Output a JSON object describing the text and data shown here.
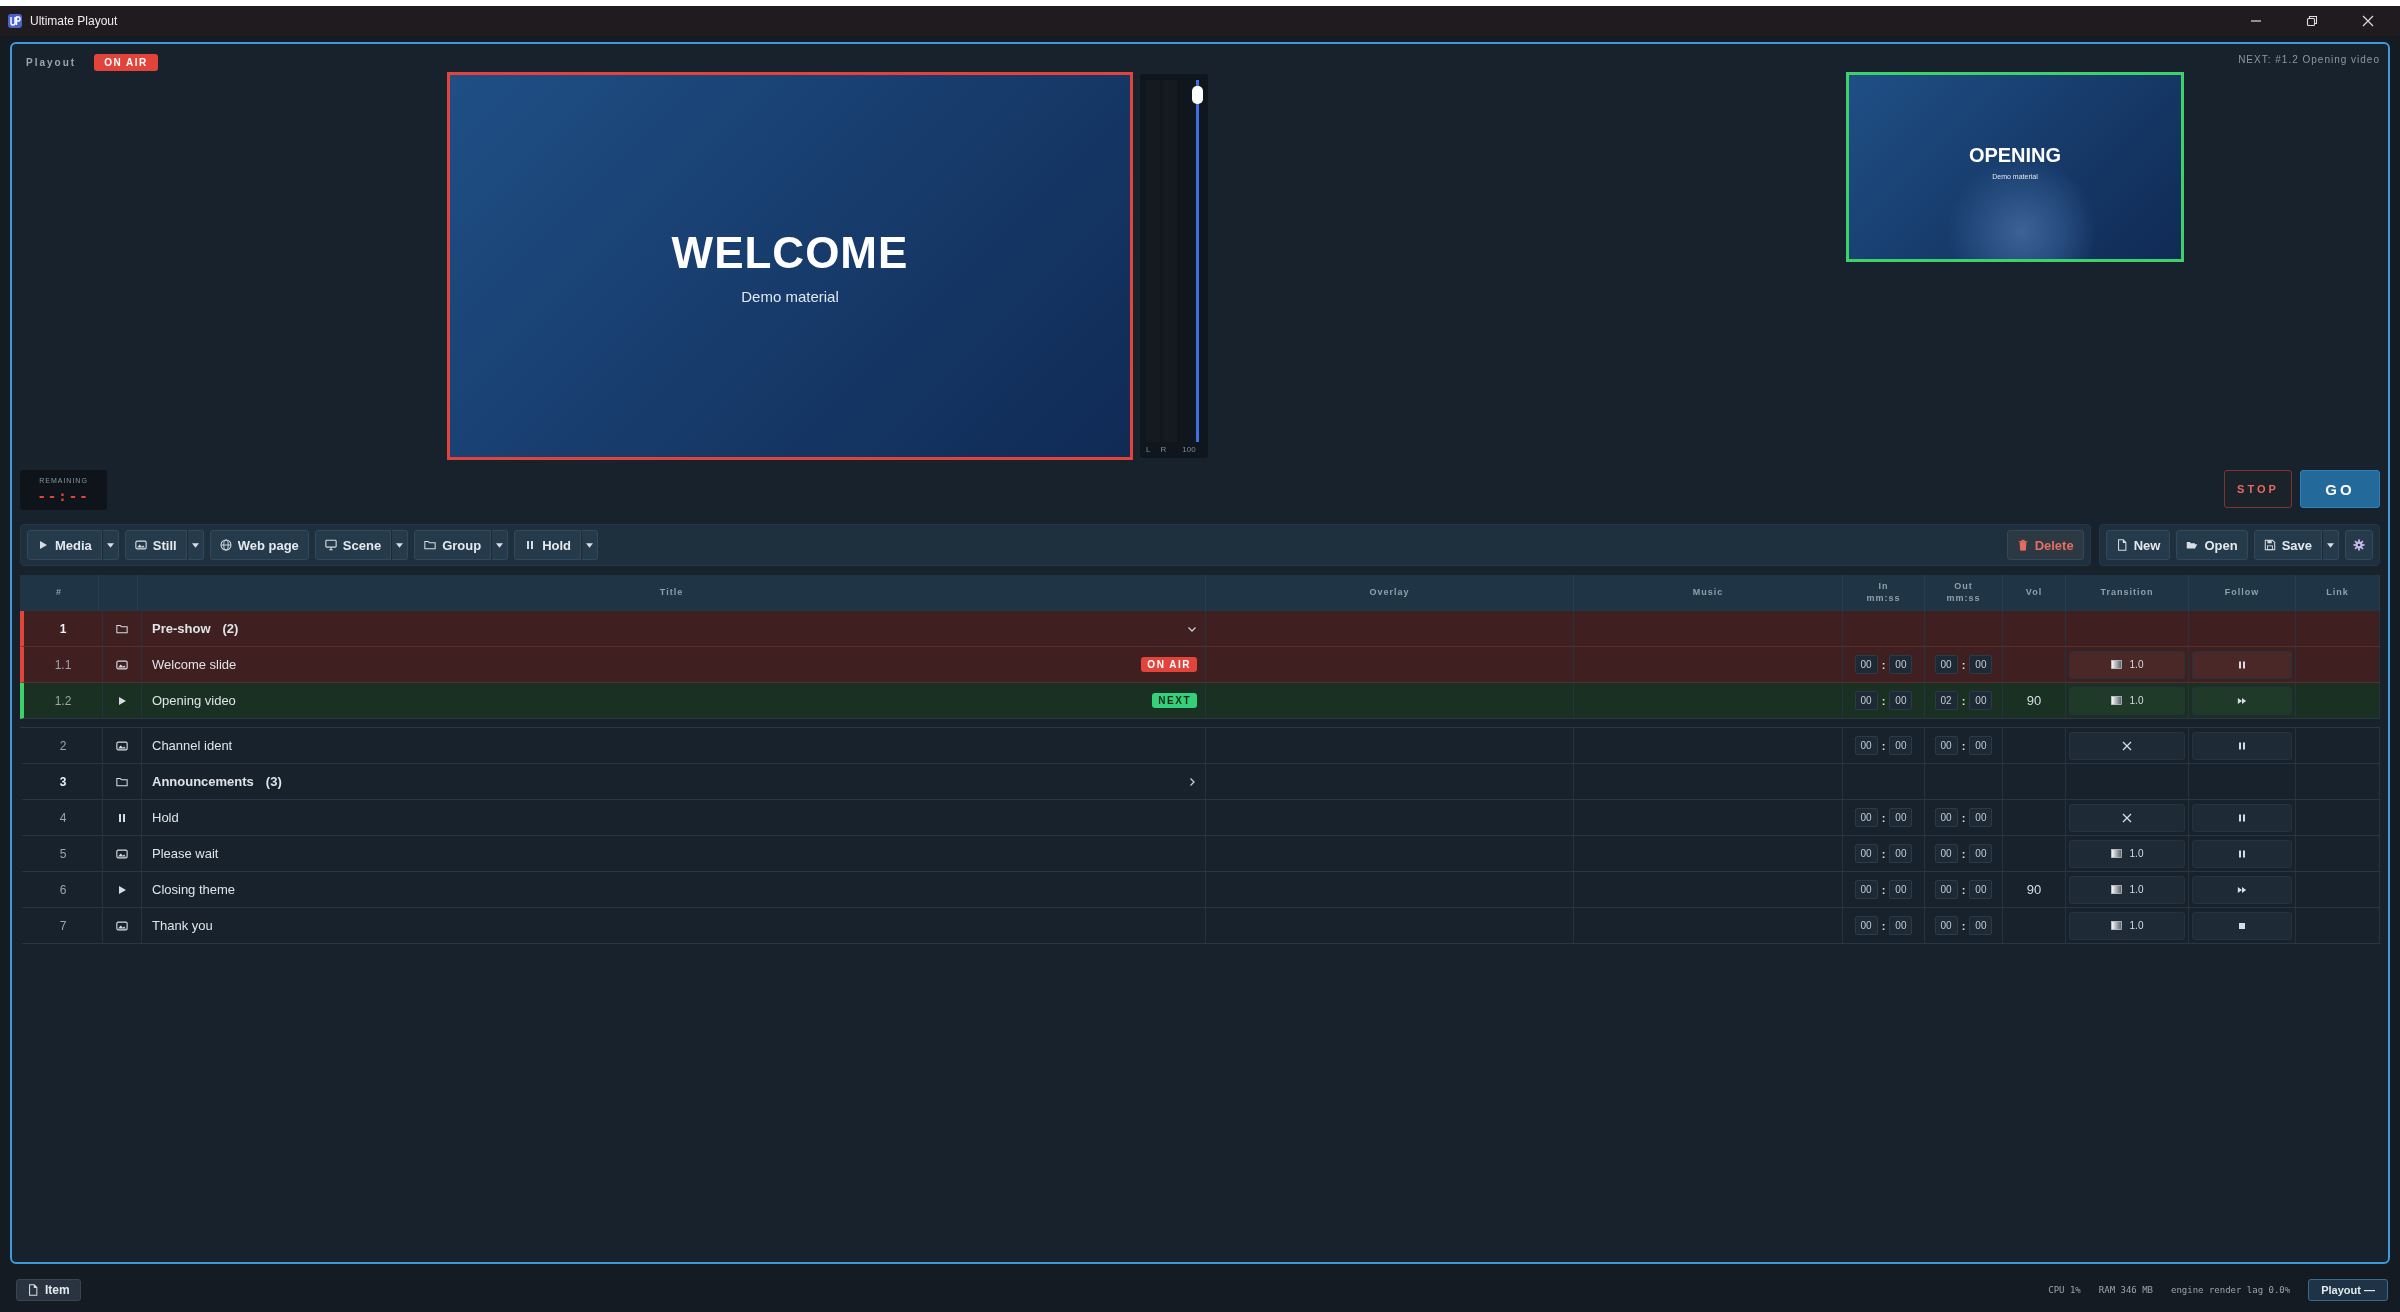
{
  "window": {
    "title": "Ultimate Playout"
  },
  "header": {
    "label": "Playout",
    "status": "ON AIR",
    "next_info": "NEXT: #1.2  Opening video"
  },
  "program": {
    "title": "WELCOME",
    "subtitle": "Demo material"
  },
  "meter": {
    "channels": [
      "L",
      "R"
    ],
    "volume_label": "100",
    "level": 1.0
  },
  "preview": {
    "title": "OPENING",
    "subtitle": "Demo material"
  },
  "remaining": {
    "label": "REMAINING",
    "value": "--:--"
  },
  "transport": [
    {
      "kind": "stop",
      "label": "STOP"
    },
    {
      "kind": "go",
      "label": "GO"
    }
  ],
  "toolbar": {
    "add": [
      {
        "kind": "media",
        "label": "Media",
        "dropdown": true
      },
      {
        "kind": "still",
        "label": "Still",
        "dropdown": true
      },
      {
        "kind": "web",
        "label": "Web page",
        "dropdown": false
      },
      {
        "kind": "scene",
        "label": "Scene",
        "dropdown": true
      },
      {
        "kind": "group",
        "label": "Group",
        "dropdown": true
      },
      {
        "kind": "hold",
        "label": "Hold",
        "dropdown": true
      }
    ],
    "delete": "Delete",
    "file": [
      {
        "kind": "new",
        "label": "New",
        "dropdown": false
      },
      {
        "kind": "open",
        "label": "Open",
        "dropdown": false
      },
      {
        "kind": "save",
        "label": "Save",
        "dropdown": true
      }
    ]
  },
  "table": {
    "columns": [
      {
        "label": "#"
      },
      {
        "label": "Title"
      },
      {
        "label": "Overlay"
      },
      {
        "label": "Music"
      },
      {
        "label": "In",
        "sub": "mm:ss"
      },
      {
        "label": "Out",
        "sub": "mm:ss"
      },
      {
        "label": "Vol"
      },
      {
        "label": "Transition"
      },
      {
        "label": "Follow"
      },
      {
        "label": "Link"
      }
    ],
    "rows": [
      {
        "num": "1",
        "kind": "group",
        "title": "Pre-show",
        "count": "(2)",
        "expanded": true,
        "on_air": true,
        "next": false,
        "children": [
          {
            "num": "1.1",
            "kind": "image",
            "title": "Welcome slide",
            "on_air": true,
            "next": false,
            "badge": "ON AIR",
            "in": {
              "min": "00",
              "sep": ":",
              "sec": "00"
            },
            "out": {
              "min": "00",
              "sep": ":",
              "sec": "00"
            },
            "transition": {
              "kind": "fade",
              "duration": "1.0"
            },
            "follow": {
              "kind": "hold"
            }
          },
          {
            "num": "1.2",
            "kind": "video",
            "title": "Opening video",
            "on_air": false,
            "next": true,
            "badge": "NEXT",
            "in": {
              "min": "00",
              "sep": ":",
              "sec": "00"
            },
            "out": {
              "min": "02",
              "sep": ":",
              "sec": "00"
            },
            "vol": "90",
            "transition": {
              "kind": "fade",
              "duration": "1.0"
            },
            "follow": {
              "kind": "next"
            }
          }
        ]
      },
      {
        "num": "2",
        "kind": "image",
        "title": "Channel ident",
        "on_air": false,
        "next": false,
        "in": {
          "min": "00",
          "sep": ":",
          "sec": "00"
        },
        "out": {
          "min": "00",
          "sep": ":",
          "sec": "00"
        },
        "transition": {
          "kind": "cut"
        },
        "follow": {
          "kind": "hold"
        }
      },
      {
        "num": "3",
        "kind": "group",
        "title": "Announcements",
        "count": "(3)",
        "expanded": false,
        "on_air": false,
        "next": false
      },
      {
        "num": "4",
        "kind": "hold",
        "title": "Hold",
        "on_air": false,
        "next": false,
        "in": {
          "min": "00",
          "sep": ":",
          "sec": "00"
        },
        "out": {
          "min": "00",
          "sep": ":",
          "sec": "00"
        },
        "transition": {
          "kind": "cut"
        },
        "follow": {
          "kind": "hold"
        }
      },
      {
        "num": "5",
        "kind": "image",
        "title": "Please wait",
        "on_air": false,
        "next": false,
        "in": {
          "min": "00",
          "sep": ":",
          "sec": "00"
        },
        "out": {
          "min": "00",
          "sep": ":",
          "sec": "00"
        },
        "transition": {
          "kind": "fade",
          "duration": "1.0"
        },
        "follow": {
          "kind": "hold"
        }
      },
      {
        "num": "6",
        "kind": "video",
        "title": "Closing theme",
        "on_air": false,
        "next": false,
        "in": {
          "min": "00",
          "sep": ":",
          "sec": "00"
        },
        "out": {
          "min": "00",
          "sep": ":",
          "sec": "00"
        },
        "vol": "90",
        "transition": {
          "kind": "fade",
          "duration": "1.0"
        },
        "follow": {
          "kind": "next"
        }
      },
      {
        "num": "7",
        "kind": "image",
        "title": "Thank you",
        "on_air": false,
        "next": false,
        "in": {
          "min": "00",
          "sep": ":",
          "sec": "00"
        },
        "out": {
          "min": "00",
          "sep": ":",
          "sec": "00"
        },
        "transition": {
          "kind": "fade",
          "duration": "1.0"
        },
        "follow": {
          "kind": "stop"
        }
      }
    ]
  },
  "status_bar": {
    "item_button": "Item",
    "stats": [
      "CPU 1%",
      "RAM 346 MB",
      "engine render lag 0.0%"
    ],
    "mode": "Playout —"
  }
}
